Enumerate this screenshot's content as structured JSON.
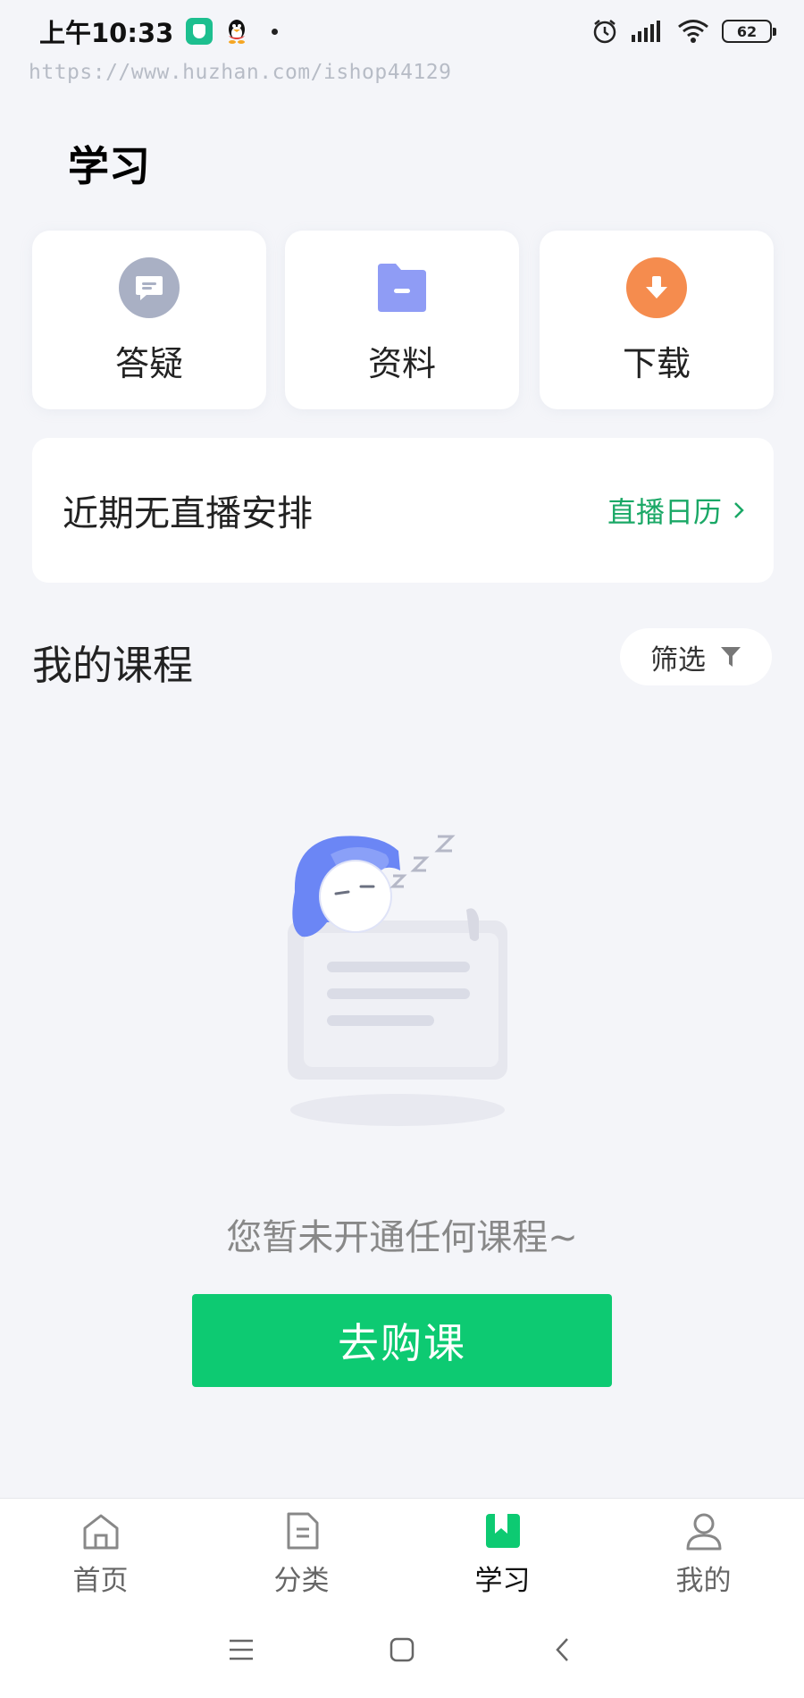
{
  "status_bar": {
    "time": "上午10:33",
    "battery": "62",
    "icons": [
      "shield-app-icon",
      "qq-penguin-icon",
      "alarm-icon",
      "signal-icon",
      "wifi-icon",
      "battery-icon"
    ]
  },
  "watermark": "https://www.huzhan.com/ishop44129",
  "page": {
    "title": "学习"
  },
  "quick_actions": [
    {
      "label": "答疑",
      "icon": "chat-bubble-icon",
      "color": "#a9b0c4"
    },
    {
      "label": "资料",
      "icon": "folder-icon",
      "color": "#8f9cf5"
    },
    {
      "label": "下载",
      "icon": "download-icon",
      "color": "#f58c4e"
    }
  ],
  "live": {
    "status_text": "近期无直播安排",
    "calendar_link": "直播日历",
    "accent": "#1aa866"
  },
  "courses": {
    "title": "我的课程",
    "filter_label": "筛选",
    "empty_text": "您暂未开通任何课程~",
    "buy_label": "去购课",
    "buy_color": "#0dca72"
  },
  "bottom_nav": {
    "items": [
      {
        "label": "首页",
        "icon": "home-icon",
        "active": false
      },
      {
        "label": "分类",
        "icon": "category-icon",
        "active": false
      },
      {
        "label": "学习",
        "icon": "study-bookmark-icon",
        "active": true
      },
      {
        "label": "我的",
        "icon": "profile-icon",
        "active": false
      }
    ],
    "active_color": "#0dca72"
  },
  "system_nav": [
    "menu-icon",
    "home-square-icon",
    "back-icon"
  ]
}
